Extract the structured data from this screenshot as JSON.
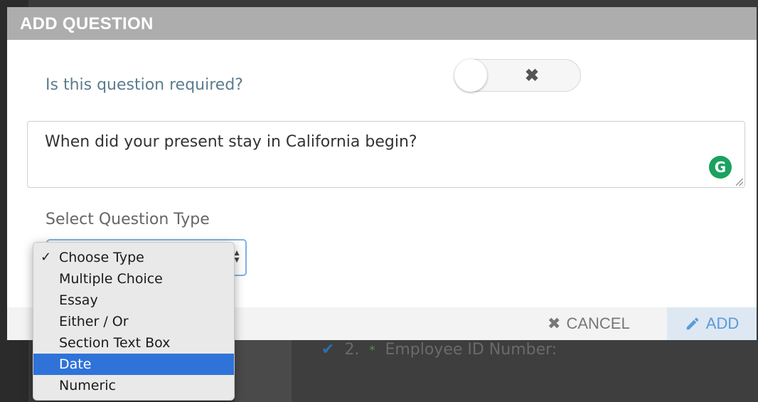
{
  "modal": {
    "title": "ADD QUESTION",
    "required_label": "Is this question required?",
    "toggle_state_glyph": "✖",
    "question_text": "When did your present stay in California begin?",
    "type_label": "Select Question Type",
    "grammarly_glyph": "G"
  },
  "dropdown": {
    "items": [
      {
        "label": "Choose Type",
        "checked": true
      },
      {
        "label": "Multiple Choice"
      },
      {
        "label": "Essay"
      },
      {
        "label": "Either / Or"
      },
      {
        "label": "Section Text Box"
      },
      {
        "label": "Date",
        "highlighted": true
      },
      {
        "label": "Numeric"
      }
    ],
    "check_glyph": "✓"
  },
  "footer": {
    "cancel_icon": "✖",
    "cancel_label": "CANCEL",
    "add_label": "ADD"
  },
  "background": {
    "row_number": "2.",
    "row_star": "*",
    "row_label": "Employee ID Number:"
  },
  "colors": {
    "header": "#adadad",
    "accent": "#5b9bd5",
    "highlight": "#2f73d9",
    "grammarly": "#1aa260"
  }
}
